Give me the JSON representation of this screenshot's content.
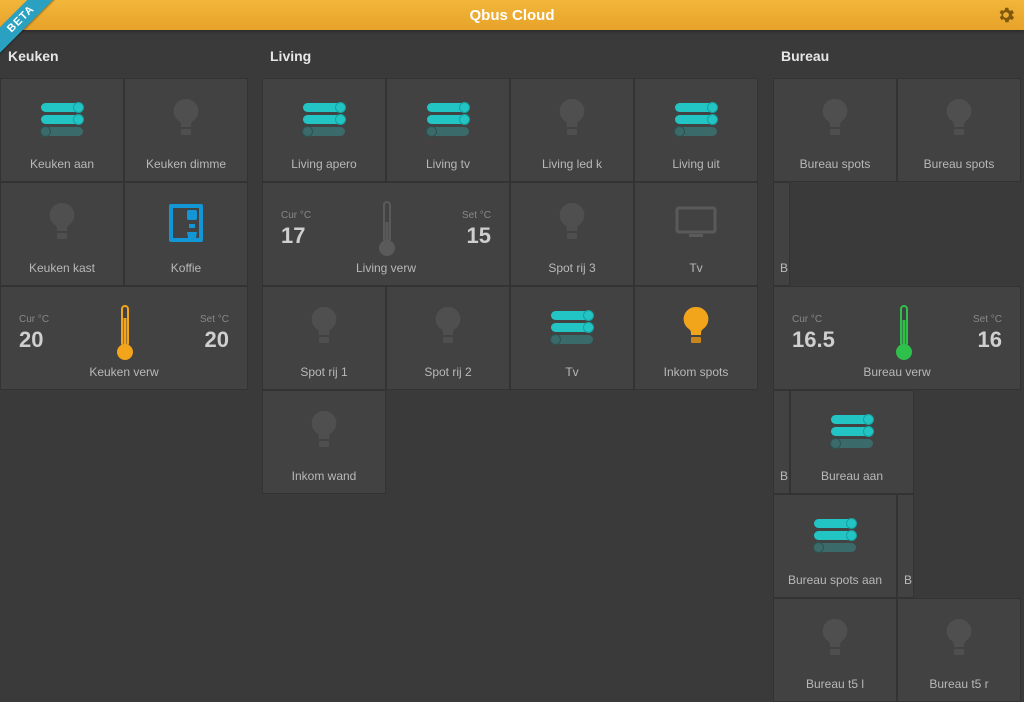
{
  "app": {
    "title": "Qbus Cloud",
    "beta_label": "BETA"
  },
  "icons": {
    "gear": "gear-icon"
  },
  "columns": {
    "keuken": {
      "title": "Keuken",
      "tiles": [
        {
          "label": "Keuken aan"
        },
        {
          "label": "Keuken dimme"
        },
        {
          "label": "Keuken kast"
        },
        {
          "label": "Koffie"
        }
      ],
      "thermo": {
        "cur_label": "Cur °C",
        "cur_val": "20",
        "set_label": "Set °C",
        "set_val": "20",
        "label": "Keuken verw"
      }
    },
    "living": {
      "title": "Living",
      "tiles": [
        {
          "label": "Living apero"
        },
        {
          "label": "Living tv"
        },
        {
          "label": "Living led k"
        },
        {
          "label": "Living uit"
        },
        {
          "label": "Spot rij 3"
        },
        {
          "label": "Tv"
        },
        {
          "label": "Spot rij 1"
        },
        {
          "label": "Spot rij 2"
        },
        {
          "label": "Tv"
        },
        {
          "label": "Inkom spots"
        },
        {
          "label": "Inkom wand"
        }
      ],
      "thermo": {
        "cur_label": "Cur °C",
        "cur_val": "17",
        "set_label": "Set °C",
        "set_val": "15",
        "label": "Living verw"
      }
    },
    "bureau": {
      "title": "Bureau",
      "tiles": [
        {
          "label": "Bureau spots"
        },
        {
          "label": "Bureau spots"
        },
        {
          "label": "B"
        },
        {
          "label": "B"
        },
        {
          "label": "Bureau aan"
        },
        {
          "label": "Bureau spots aan"
        },
        {
          "label": "Bur"
        },
        {
          "label": "Bureau t5 l"
        },
        {
          "label": "Bureau t5 r"
        }
      ],
      "thermo": {
        "cur_label": "Cur °C",
        "cur_val": "16.5",
        "set_label": "Set °C",
        "set_val": "16",
        "label": "Bureau verw"
      }
    }
  }
}
